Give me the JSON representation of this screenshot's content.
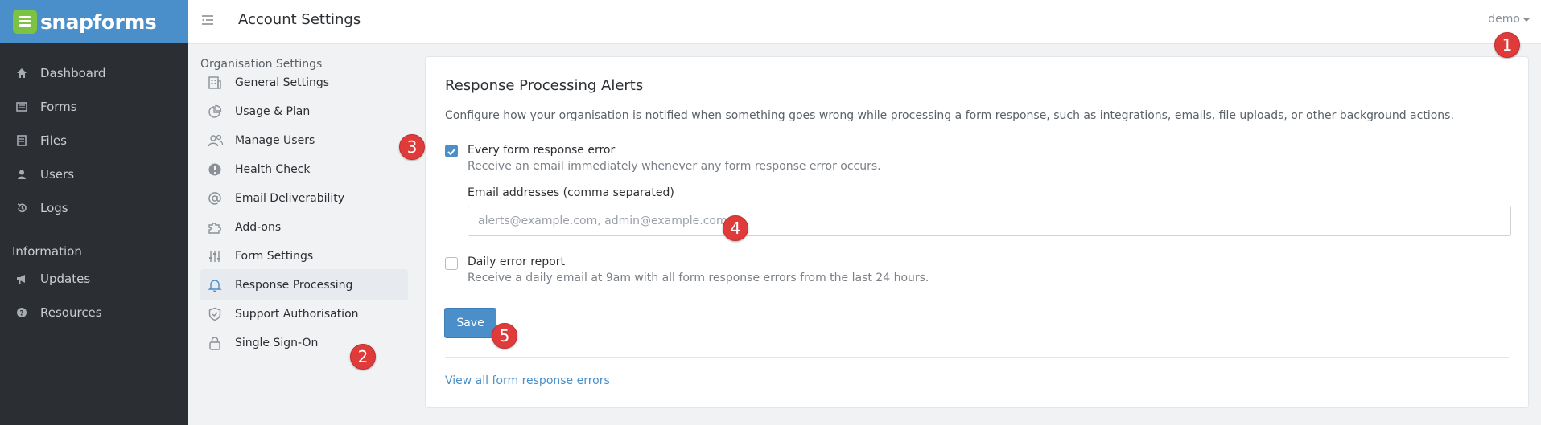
{
  "brand": {
    "name": "snapforms",
    "color": "#4a8fc9",
    "logo_color": "#7cc243"
  },
  "nav": {
    "items": [
      {
        "label": "Dashboard",
        "icon": "home-icon"
      },
      {
        "label": "Forms",
        "icon": "list-icon"
      },
      {
        "label": "Files",
        "icon": "file-icon"
      },
      {
        "label": "Users",
        "icon": "user-icon"
      },
      {
        "label": "Logs",
        "icon": "history-icon"
      }
    ],
    "section_heading": "Information",
    "info_items": [
      {
        "label": "Updates",
        "icon": "megaphone-icon"
      },
      {
        "label": "Resources",
        "icon": "help-circle-icon"
      }
    ]
  },
  "header": {
    "title": "Account Settings",
    "user": "demo"
  },
  "settings_menu": {
    "heading": "Organisation Settings",
    "items": [
      {
        "label": "General Settings",
        "icon": "building-icon"
      },
      {
        "label": "Usage & Plan",
        "icon": "pie-chart-icon"
      },
      {
        "label": "Manage Users",
        "icon": "users-icon"
      },
      {
        "label": "Health Check",
        "icon": "alert-circle-icon"
      },
      {
        "label": "Email Deliverability",
        "icon": "at-sign-icon"
      },
      {
        "label": "Add-ons",
        "icon": "puzzle-icon"
      },
      {
        "label": "Form Settings",
        "icon": "sliders-icon"
      },
      {
        "label": "Response Processing",
        "icon": "bell-icon",
        "active": true
      },
      {
        "label": "Support Authorisation",
        "icon": "shield-check-icon"
      },
      {
        "label": "Single Sign-On",
        "icon": "lock-icon"
      }
    ]
  },
  "panel": {
    "title": "Response Processing Alerts",
    "description": "Configure how your organisation is notified when something goes wrong while processing a form response, such as integrations, emails, file uploads, or other background actions.",
    "every_error": {
      "label": "Every form response error",
      "help": "Receive an email immediately whenever any form response error occurs.",
      "checked": true
    },
    "email": {
      "label": "Email addresses (comma separated)",
      "value": "",
      "placeholder": "alerts@example.com, admin@example.com"
    },
    "daily_report": {
      "label": "Daily error report",
      "help": "Receive a daily email at 9am with all form response errors from the last 24 hours.",
      "checked": false
    },
    "save_label": "Save",
    "errors_link": "View all form response errors"
  },
  "markers": [
    "1",
    "2",
    "3",
    "4",
    "5"
  ],
  "colors": {
    "sidebar": "#2b2f33",
    "accent": "#4a8fc9",
    "marker": "#e03b3b"
  }
}
